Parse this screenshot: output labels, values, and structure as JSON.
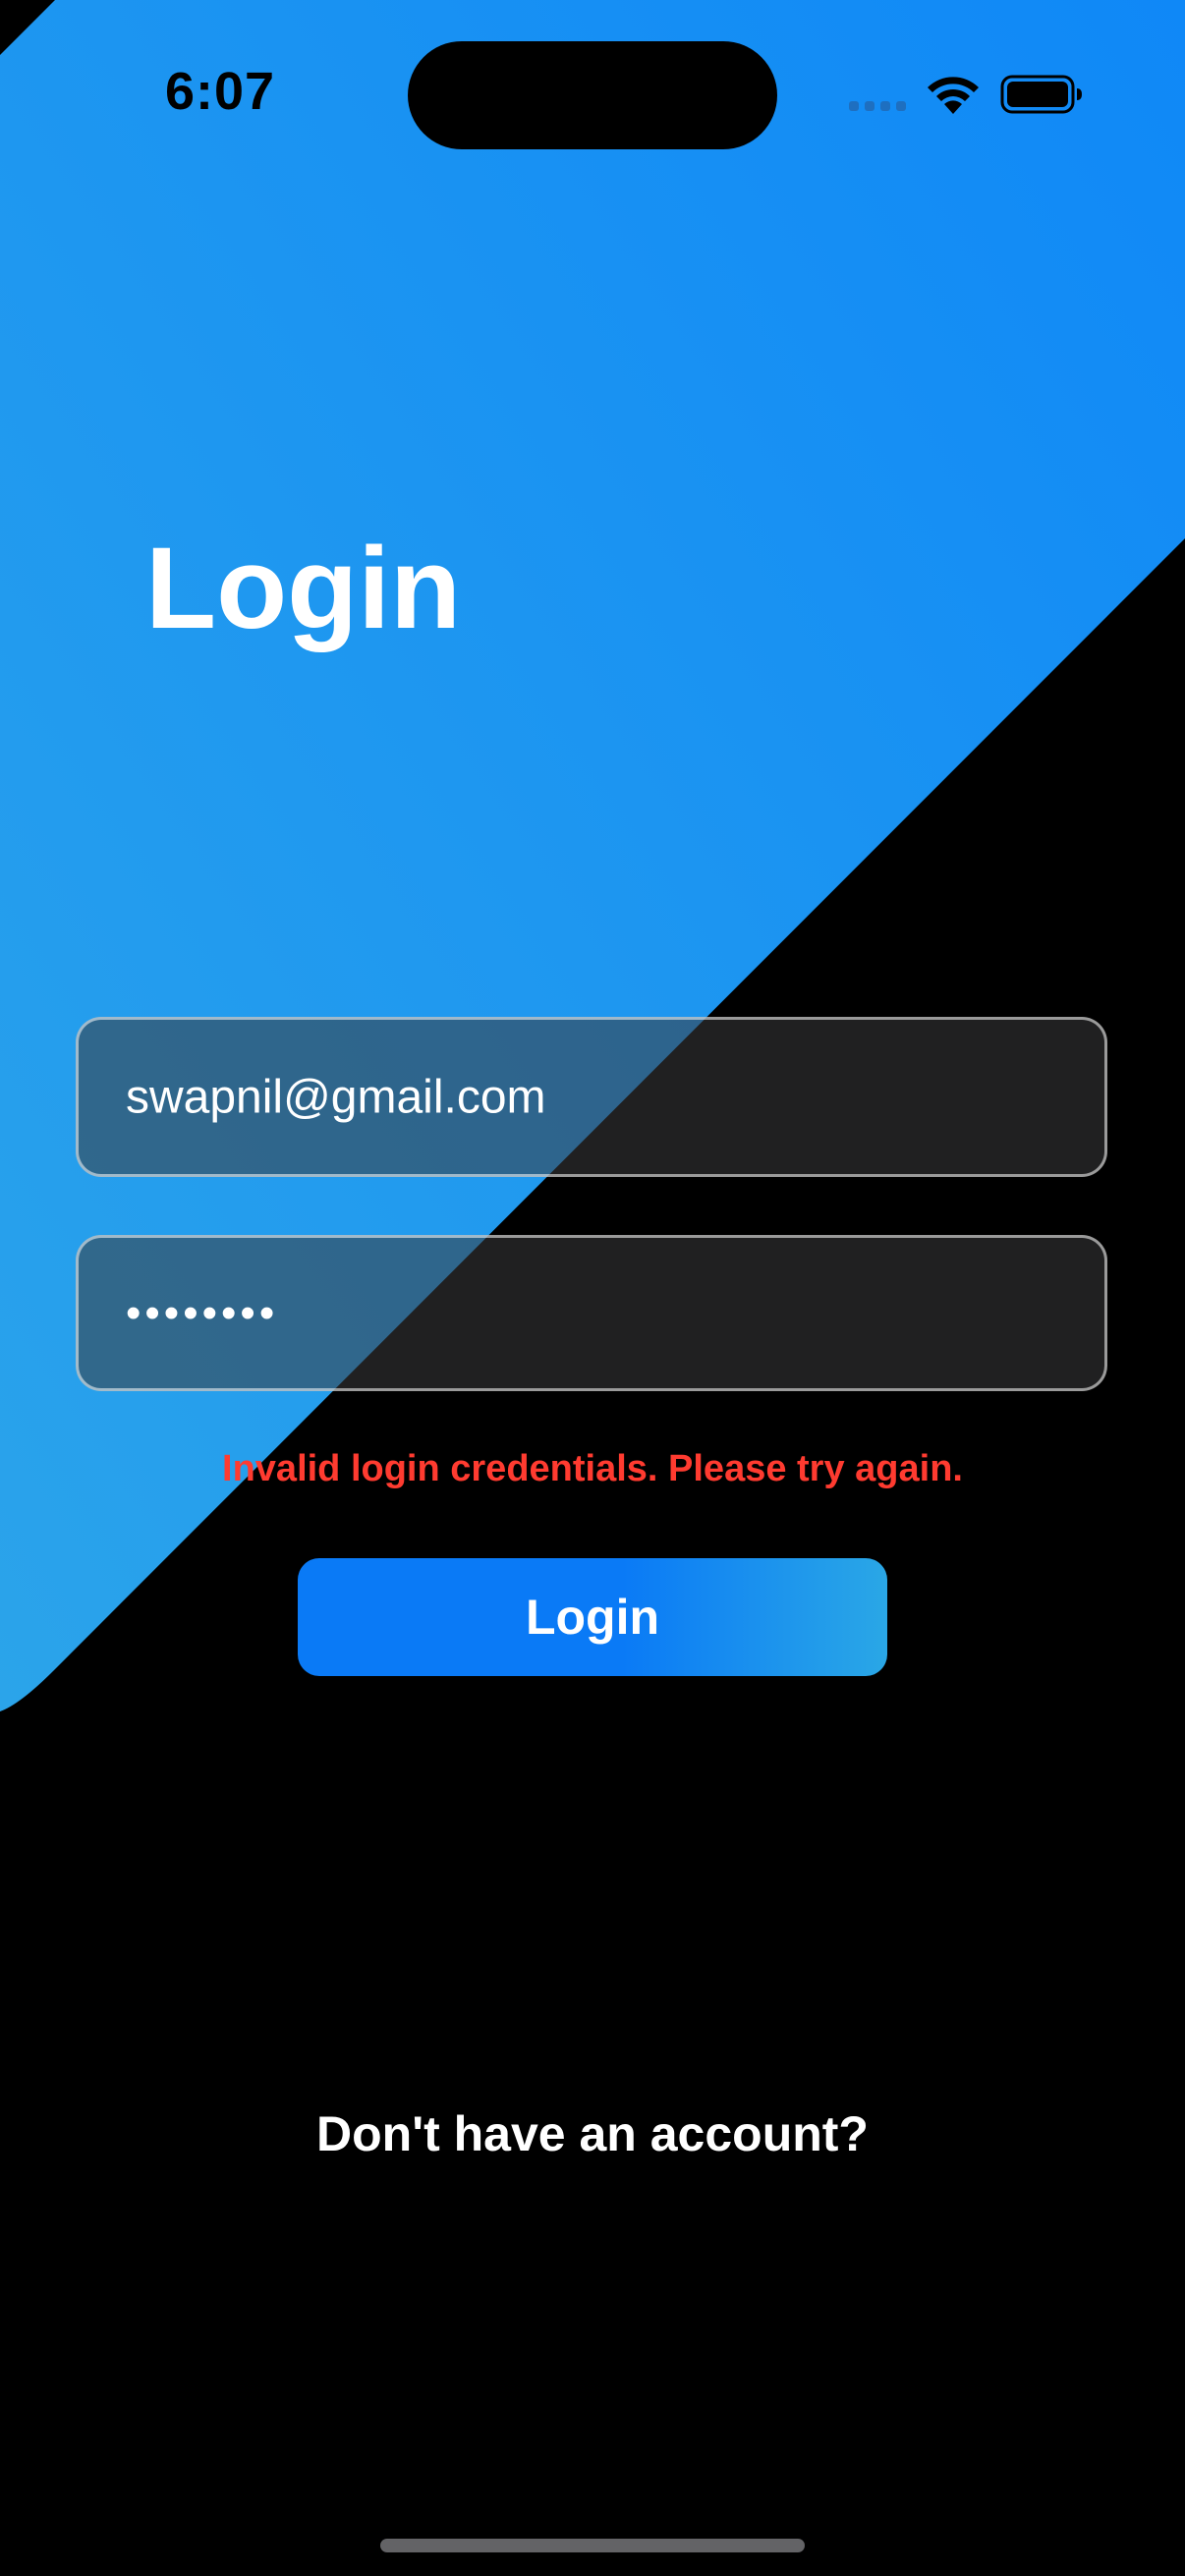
{
  "status_bar": {
    "time": "6:07"
  },
  "login": {
    "title": "Login",
    "email_value": "swapnil@gmail.com",
    "password_display": "••••••••",
    "error_message": "Invalid login credentials. Please try again.",
    "login_button_label": "Login",
    "signup_prompt": "Don't have an account?"
  },
  "colors": {
    "background": "#000000",
    "accent_gradient_start": "#2ba4ea",
    "accent_gradient_end": "#0f88f7",
    "error": "#ff3b30",
    "button": "#0a7af6"
  },
  "icons": [
    "signal-icon",
    "wifi-icon",
    "battery-icon"
  ]
}
